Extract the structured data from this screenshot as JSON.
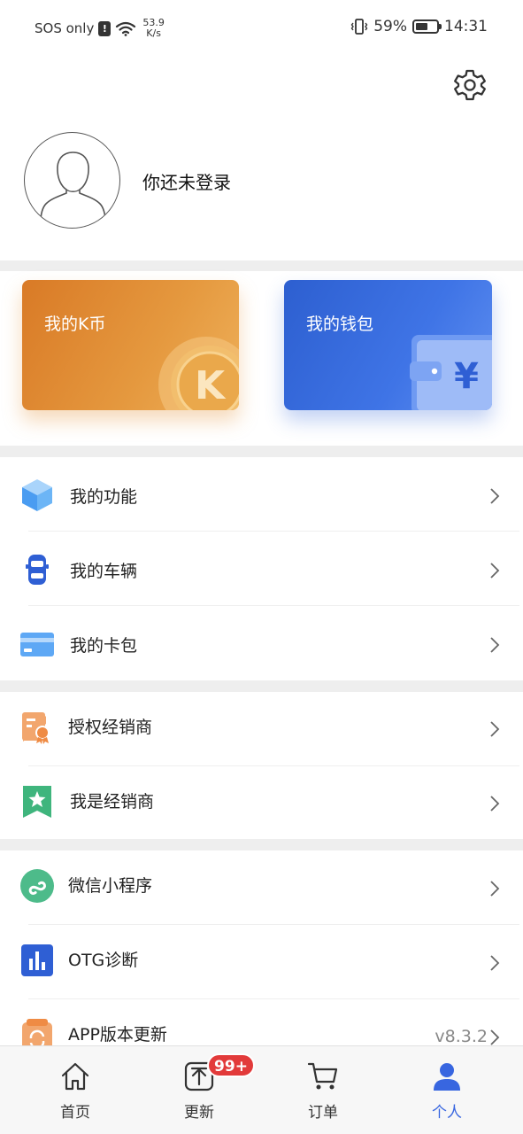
{
  "status_bar": {
    "carrier": "SOS only",
    "alert": "!",
    "net_type": "6",
    "speed_value": "53.9",
    "speed_unit": "K/s",
    "battery": "59%",
    "battery_level": 0.59,
    "time": "14:31"
  },
  "header": {
    "settings_icon": "gear-icon",
    "avatar_icon": "default-avatar-icon",
    "login_prompt": "你还未登录"
  },
  "cards": {
    "kcoin": {
      "label": "我的K币",
      "coin_letter": "K",
      "color": "#e08a32"
    },
    "wallet": {
      "label": "我的钱包",
      "currency_symbol": "¥",
      "color": "#3a6ce0"
    }
  },
  "menu_group_1": [
    {
      "label": "我的功能",
      "icon": "cube-icon"
    },
    {
      "label": "我的车辆",
      "icon": "car-icon"
    },
    {
      "label": "我的卡包",
      "icon": "card-icon"
    }
  ],
  "menu_group_2": [
    {
      "label": "授权经销商",
      "icon": "certificate-icon"
    },
    {
      "label": "我是经销商",
      "icon": "star-bookmark-icon"
    }
  ],
  "menu_group_3": [
    {
      "label": "微信小程序",
      "icon": "miniprogram-icon"
    },
    {
      "label": "OTG诊断",
      "icon": "bar-chart-icon"
    },
    {
      "label": "APP版本更新",
      "icon": "update-icon",
      "version": "v8.3.2"
    }
  ],
  "bottom_nav": {
    "items": [
      {
        "label": "首页",
        "icon": "home-icon"
      },
      {
        "label": "更新",
        "icon": "upload-icon",
        "badge": "99+"
      },
      {
        "label": "订单",
        "icon": "cart-icon"
      },
      {
        "label": "个人",
        "icon": "person-icon",
        "active": true
      }
    ]
  },
  "colors": {
    "accent": "#3866e0",
    "badge": "#e23a3a",
    "separator": "#eeeeee"
  }
}
